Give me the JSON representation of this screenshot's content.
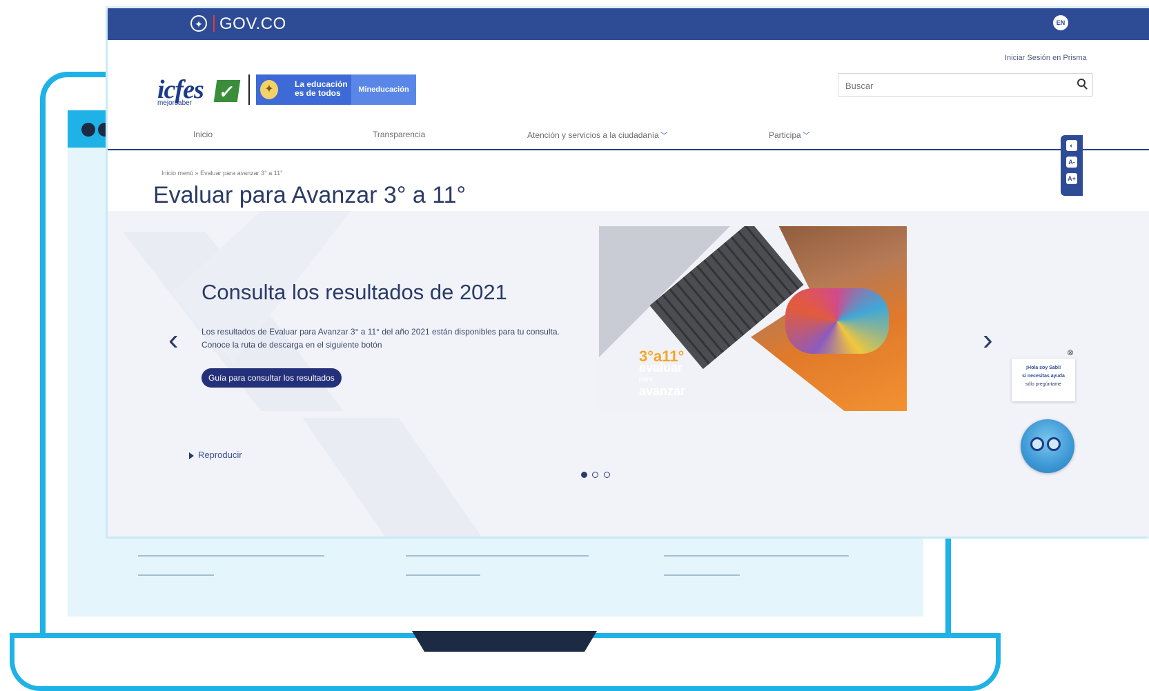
{
  "gov_bar": {
    "brand": "GOV.CO",
    "lang_button": "EN"
  },
  "header": {
    "login_link": "Iniciar Sesión en Prisma",
    "search_placeholder": "Buscar",
    "logo": {
      "icfes_word": "icfes",
      "icfes_tagline": "mejorsaber",
      "mined_slogan": "La educación es de todos",
      "mined_name": "Mineducación"
    }
  },
  "nav": {
    "items": [
      {
        "label": "Inicio",
        "dropdown": false
      },
      {
        "label": "Transparencia",
        "dropdown": false
      },
      {
        "label": "Atención y servicios a la ciudadanía",
        "dropdown": true
      },
      {
        "label": "Participa",
        "dropdown": true
      }
    ],
    "menu_icon": "hamburger-icon"
  },
  "breadcrumb": {
    "root": "Inicio menú",
    "separator": "»",
    "current": "Evaluar para avanzar 3° a 11°"
  },
  "page_title": "Evaluar para Avanzar 3° a 11°",
  "hero": {
    "title": "Consulta los resultados de 2021",
    "description_line1": "Los resultados de Evaluar para Avanzar 3° a 11° del año 2021 están disponibles para tu consulta.",
    "description_line2": "Conoce la ruta de descarga en el siguiente botón",
    "button_label": "Guía para consultar los resultados",
    "play_label": "Reproducir",
    "slides_total": 3,
    "slide_active": 1,
    "image_text": {
      "num": "3°a11°",
      "line1": "evaluar",
      "line2": "para",
      "line3": "avanzar"
    }
  },
  "accessibility": {
    "buttons": [
      "contrast-icon",
      "font-decrease-icon",
      "font-increase-icon"
    ],
    "labels": [
      "◐",
      "A-",
      "A+"
    ]
  },
  "chat": {
    "line1": "¡Hola soy Sabi!",
    "line2": "si necesitas ayuda",
    "line3": "sólo pregúntame"
  },
  "colors": {
    "gov_blue": "#2e4b96",
    "title_navy": "#2b3a66",
    "laptop_cyan": "#1fb2e6",
    "button_navy": "#25307a"
  }
}
